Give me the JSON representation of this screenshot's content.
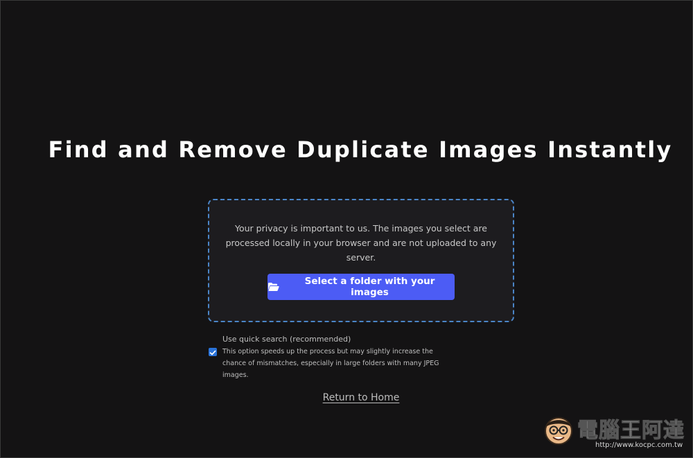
{
  "page": {
    "title": "Find and Remove Duplicate Images Instantly"
  },
  "dropzone": {
    "privacy_text": "Your privacy is important to us. The images you select are processed locally in your browser and are not uploaded to any server.",
    "select_button_label": "Select a folder with your images",
    "select_button_icon": "folder-open-icon"
  },
  "options": {
    "quick_search_checked": true,
    "quick_search_label": "Use quick search (recommended)",
    "quick_search_description": "This option speeds up the process but may slightly increase the chance of mismatches, especially in large folders with many JPEG images."
  },
  "footer": {
    "return_link_label": "Return to Home"
  },
  "watermark": {
    "logo_text": "電腦王阿達",
    "url": "http://www.kocpc.com.tw"
  },
  "colors": {
    "background": "#141314",
    "dropzone_bg": "#1d1c1f",
    "dropzone_border": "#4b86c9",
    "button_bg": "#4c5cf5",
    "checkbox_accent": "#2a73d9"
  }
}
